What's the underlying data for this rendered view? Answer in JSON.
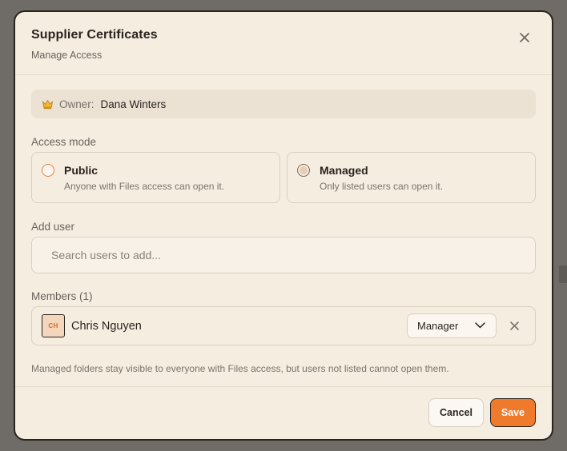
{
  "dialog": {
    "title": "Supplier Certificates",
    "subtitle": "Manage Access"
  },
  "owner": {
    "label": "Owner:",
    "name": "Dana Winters"
  },
  "access_mode": {
    "label": "Access mode",
    "options": [
      {
        "title": "Public",
        "description": "Anyone with Files access can open it.",
        "selected": false
      },
      {
        "title": "Managed",
        "description": "Only listed users can open it.",
        "selected": true
      }
    ]
  },
  "add_user": {
    "label": "Add user",
    "placeholder": "Search users to add...",
    "value": ""
  },
  "members": {
    "label": "Members (1)",
    "items": [
      {
        "initials": "CH",
        "name": "Chris Nguyen",
        "role": "Manager"
      }
    ]
  },
  "note": "Managed folders stay visible to everyone with Files access, but users not listed cannot open them.",
  "footer": {
    "cancel_label": "Cancel",
    "save_label": "Save"
  },
  "colors": {
    "accent": "#ef7a2c",
    "dialog_background": "#f6ede1",
    "crown": "#e8a21a"
  },
  "icons": {
    "close": "close-icon",
    "owner": "crown-icon",
    "role_dropdown": "chevron-down-icon",
    "remove_member": "remove-icon"
  }
}
